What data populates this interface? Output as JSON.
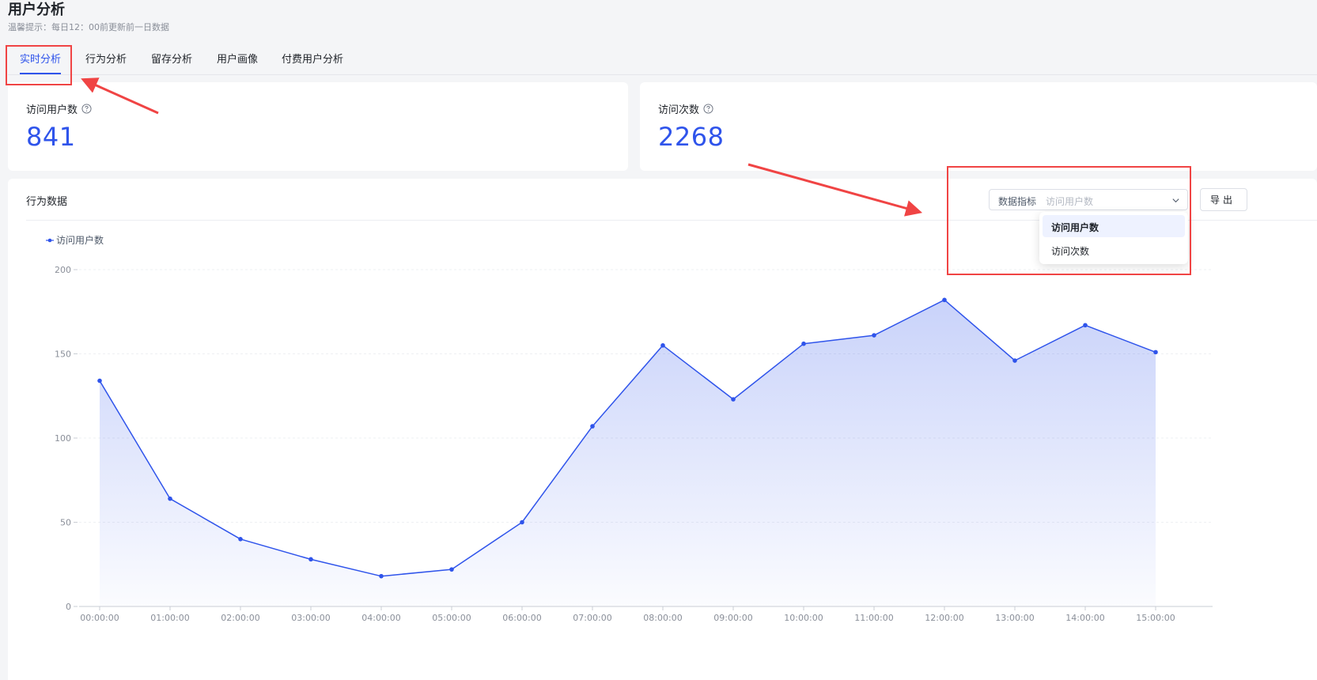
{
  "page": {
    "title": "用户分析",
    "subtitle": "温馨提示：每日12：00前更新前一日数据"
  },
  "tabs": [
    {
      "label": "实时分析",
      "active": true
    },
    {
      "label": "行为分析",
      "active": false
    },
    {
      "label": "留存分析",
      "active": false
    },
    {
      "label": "用户画像",
      "active": false
    },
    {
      "label": "付费用户分析",
      "active": false
    }
  ],
  "stats": [
    {
      "label": "访问用户数",
      "value": "841"
    },
    {
      "label": "访问次数",
      "value": "2268"
    }
  ],
  "behavior": {
    "title": "行为数据",
    "metric_select": {
      "label": "数据指标",
      "placeholder": "访问用户数",
      "options": [
        {
          "label": "访问用户数",
          "selected": true
        },
        {
          "label": "访问次数",
          "selected": false
        }
      ]
    },
    "export_label": "导出"
  },
  "colors": {
    "accent": "#2f54eb",
    "annotation": "#f04444"
  },
  "chart_data": {
    "type": "area",
    "series": [
      {
        "name": "访问用户数",
        "values": [
          134,
          64,
          40,
          28,
          18,
          22,
          50,
          107,
          155,
          123,
          156,
          161,
          182,
          146,
          167,
          151
        ]
      }
    ],
    "categories": [
      "00:00:00",
      "01:00:00",
      "02:00:00",
      "03:00:00",
      "04:00:00",
      "05:00:00",
      "06:00:00",
      "07:00:00",
      "08:00:00",
      "09:00:00",
      "10:00:00",
      "11:00:00",
      "12:00:00",
      "13:00:00",
      "14:00:00",
      "15:00:00"
    ],
    "yticks": [
      "0",
      "50",
      "100",
      "150",
      "200"
    ],
    "ylim": [
      0,
      200
    ],
    "grid": true,
    "legend_position": "top-left",
    "title": "",
    "xlabel": "",
    "ylabel": ""
  }
}
